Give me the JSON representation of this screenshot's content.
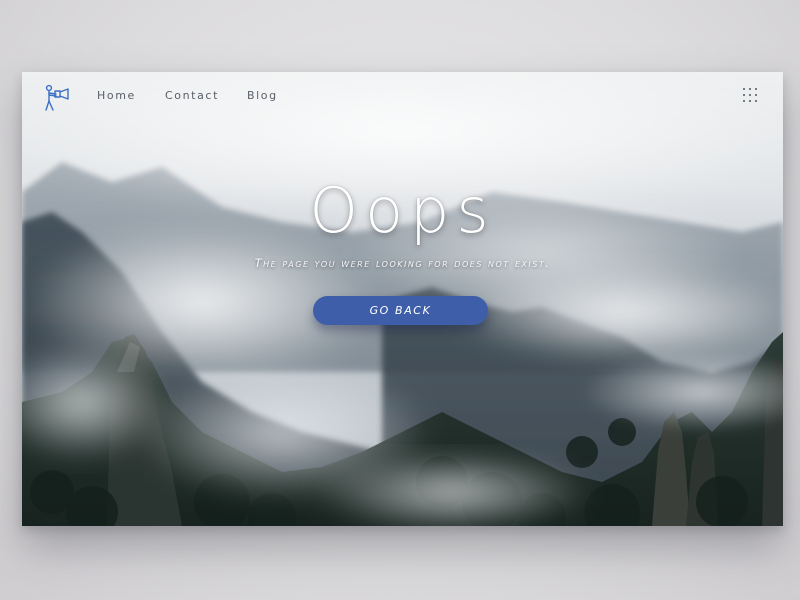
{
  "nav": {
    "logo_icon": "photographer-with-camera-icon",
    "links": [
      {
        "label": "Home"
      },
      {
        "label": "Contact"
      },
      {
        "label": "Blog"
      }
    ],
    "menu_icon": "grid-dots-icon"
  },
  "hero": {
    "title": "Oops",
    "subtitle": "The page you were looking for does not exist.",
    "button_label": "GO BACK"
  },
  "colors": {
    "accent": "#3e5eaa",
    "nav_text": "#5a6068",
    "logo": "#3b6fc4"
  }
}
